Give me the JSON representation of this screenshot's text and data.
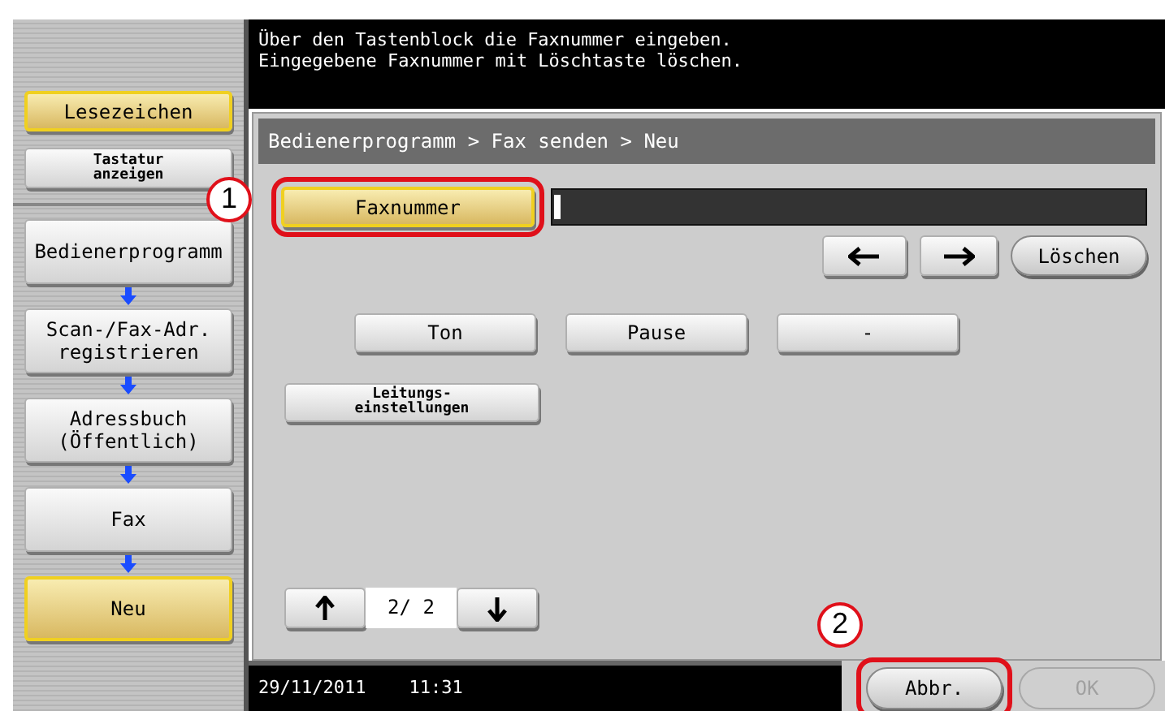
{
  "sidebar": {
    "items": [
      {
        "kind": "button",
        "label": "Lesezeichen",
        "selected": true
      },
      {
        "kind": "small",
        "label": "Tastatur\nanzeigen",
        "selected": false
      },
      {
        "kind": "step",
        "label": "Bedienerprogramm",
        "selected": false
      },
      {
        "kind": "step",
        "label": "Scan-/Fax-Adr.\nregistrieren",
        "selected": false
      },
      {
        "kind": "step",
        "label": "Adressbuch\n(Öffentlich)",
        "selected": false
      },
      {
        "kind": "step",
        "label": "Fax",
        "selected": false
      },
      {
        "kind": "step",
        "label": "Neu",
        "selected": true
      }
    ]
  },
  "message": "Über den Tastenblock die Faxnummer eingeben.\nEingegebene Faxnummer mit Löschtaste löschen.",
  "breadcrumb": "Bedienerprogramm > Fax senden > Neu",
  "fax_number": {
    "label": "Faxnummer",
    "selected": true,
    "callout": "1"
  },
  "cursor_buttons": {
    "delete": "Löschen"
  },
  "keys": [
    "Ton",
    "Pause",
    "-"
  ],
  "line_settings": "Leitungs-\neinstellungen",
  "pager": {
    "page": "2/ 2"
  },
  "status_bar": {
    "datetime": "29/11/2011    11:31"
  },
  "actions": [
    {
      "label": "Abbr.",
      "disabled": false,
      "callout": "2"
    },
    {
      "label": "OK",
      "disabled": true
    }
  ]
}
